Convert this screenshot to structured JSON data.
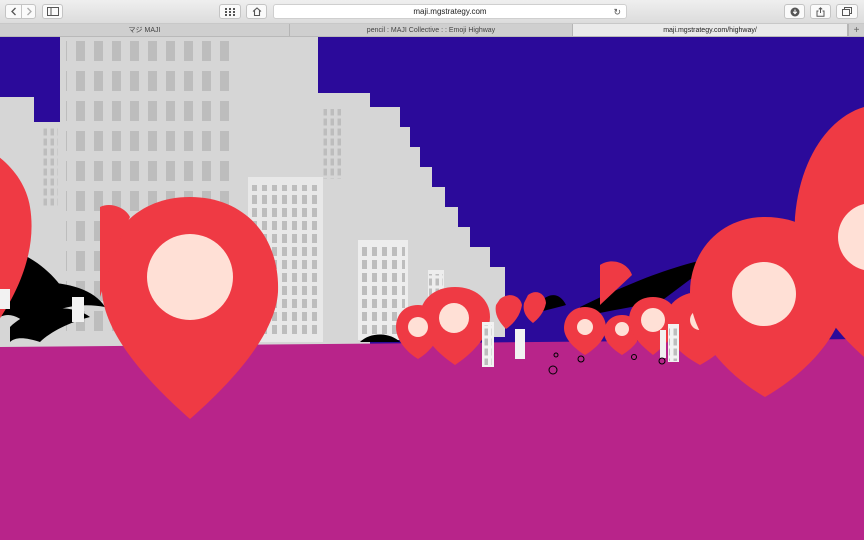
{
  "browser": {
    "url": "maji.mgstrategy.com",
    "tabs": [
      {
        "label": "マジ MAJI",
        "active": false
      },
      {
        "label": "pencil : MAJI Collective : : Emoji Highway",
        "active": false
      },
      {
        "label": "maji.mgstrategy.com/highway/",
        "active": true
      }
    ],
    "icons": {
      "back": "chevron-left-icon",
      "forward": "chevron-right-icon",
      "sidebar": "sidebar-icon",
      "top_sites": "grid-icon",
      "home": "home-icon",
      "reload": "reload-icon",
      "downloads": "download-icon",
      "share": "share-icon",
      "tabs_overview": "tabs-icon",
      "new_tab": "plus-icon"
    }
  },
  "scene": {
    "colors": {
      "sky": "#2b0a9a",
      "ground": "#b8248a",
      "pin": "#ef3a44",
      "pin_dot": "#ffe0d6",
      "building": "#d6d6d6",
      "window": "#bdbdbd"
    }
  }
}
